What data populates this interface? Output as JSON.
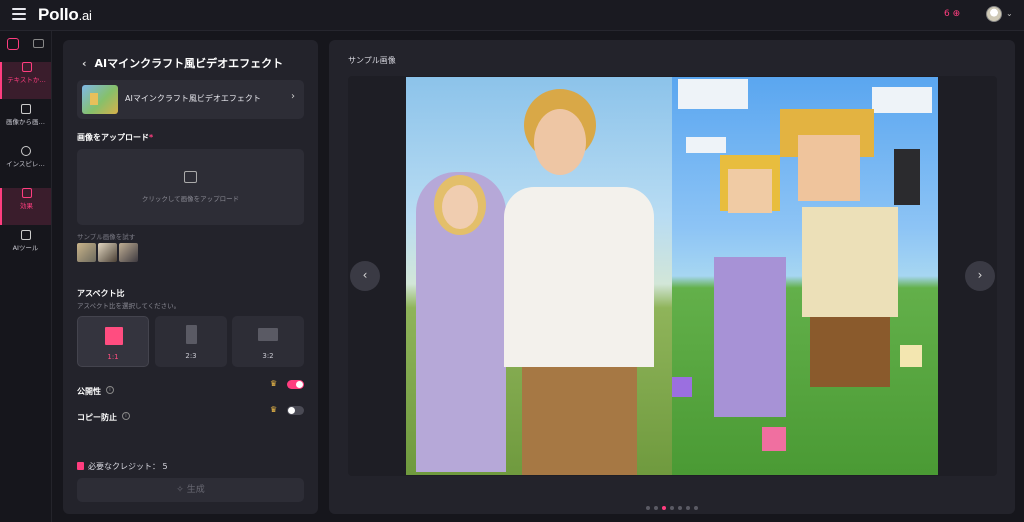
{
  "app": {
    "logo_main": "Pollo",
    "logo_suffix": ".ai",
    "credits": "6 ⊕"
  },
  "rail": {
    "items": [
      {
        "label": "テキストか…",
        "icon": "image-icon",
        "active": true
      },
      {
        "label": "画像から画…",
        "icon": "image-to-image-icon",
        "active": false
      },
      {
        "label": "インスピレ…",
        "icon": "compass-icon",
        "active": false
      },
      {
        "label": "効果",
        "icon": "effects-icon",
        "active": true
      },
      {
        "label": "AIツール",
        "icon": "robot-icon",
        "active": false
      }
    ]
  },
  "panel": {
    "title": "AIマインクラフト風ビデオエフェクト",
    "effect_name": "AIマインクラフト風ビデオエフェクト",
    "upload_label": "画像をアップロード",
    "upload_required": "*",
    "upload_hint": "クリックして画像をアップロード",
    "sample_label": "サンプル画像を試す",
    "aspect_label": "アスペクト比",
    "aspect_sub": "アスペクト比を選択してください。",
    "ratios": [
      "1:1",
      "2:3",
      "3:2"
    ],
    "selected_ratio": "1:1",
    "public_label": "公開性",
    "public_on": true,
    "copy_protect_label": "コピー防止",
    "copy_protect_on": false,
    "credit_text": "必要なクレジット： 5",
    "generate_label": "生成"
  },
  "preview": {
    "title": "サンプル画像",
    "dot_count": 7,
    "active_dot": 2
  },
  "colors": {
    "accent": "#ff3d7f",
    "panel": "#23232b",
    "background": "#16161c"
  }
}
